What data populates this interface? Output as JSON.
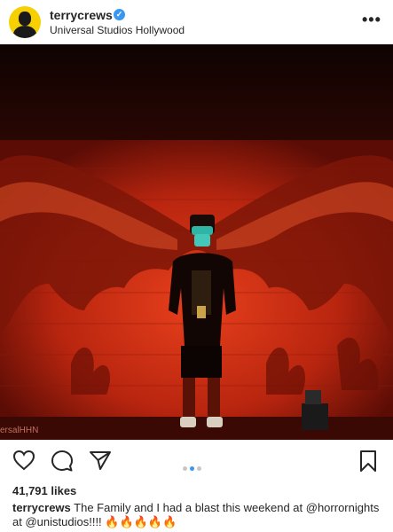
{
  "header": {
    "username": "terrycrews",
    "verified_icon": "verified-badge-icon",
    "location": "Universal Studios Hollywood",
    "more_icon": "more-options-icon",
    "more_label": "•••"
  },
  "photo": {
    "watermark": "ersalHHN",
    "description_colors": {
      "background": "#1a0503",
      "wall": "#c42a14",
      "glow": "#ff3a1a"
    }
  },
  "actions": {
    "like_icon": "heart-icon",
    "comment_icon": "comment-icon",
    "share_icon": "share-icon",
    "save_icon": "bookmark-icon",
    "carousel_total": 3,
    "carousel_active_index": 1
  },
  "likes": "41,791 likes",
  "caption": {
    "username": "terrycrews",
    "text_part1": " The Family and I had a blast this weekend at ",
    "mention1": "@horrornights",
    "text_part2": " at ",
    "mention2": "@unistudios",
    "text_part3": "!!!! 🔥🔥🔥🔥🔥"
  },
  "colors": {
    "accent": "#3897f0",
    "text": "#262626"
  }
}
